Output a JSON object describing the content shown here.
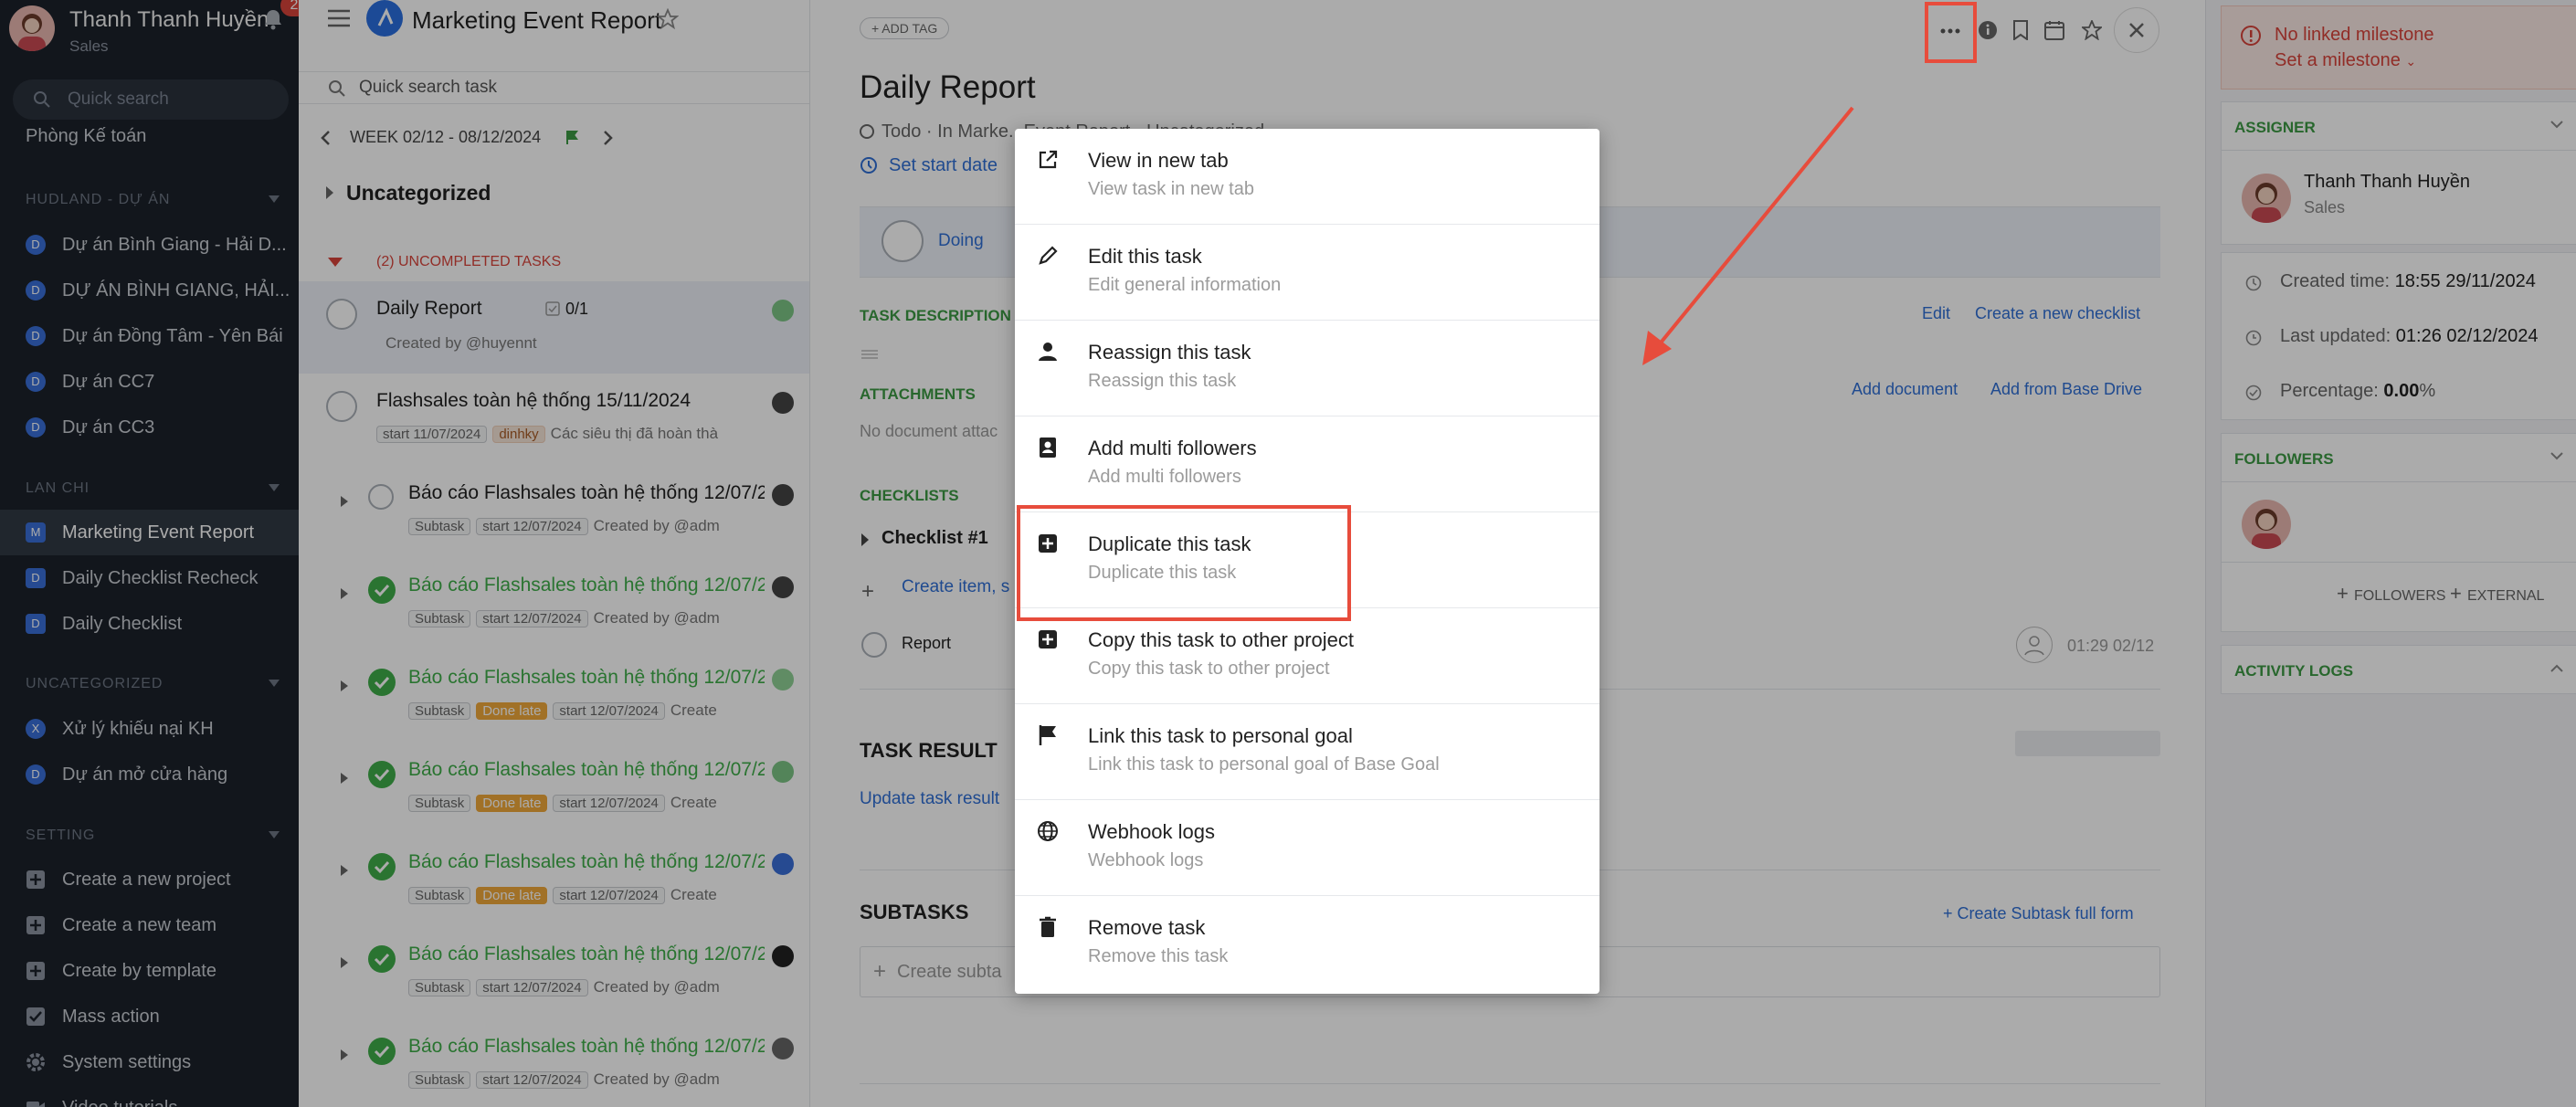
{
  "sidebar": {
    "user_name": "Thanh Thanh Huyền",
    "user_role": "Sales",
    "notif_count": "2",
    "search_placeholder": "Quick search",
    "partial_item": "Phòng Kế toán",
    "sections": [
      {
        "title": "HUDLAND - DỰ ÁN",
        "items": [
          {
            "letter": "D",
            "label": "Dự án Bình Giang - Hải D..."
          },
          {
            "letter": "D",
            "label": "DỰ ÁN BÌNH GIANG, HẢI..."
          },
          {
            "letter": "D",
            "label": "Dự án Đồng Tâm - Yên Bái"
          },
          {
            "letter": "D",
            "label": "Dự án CC7"
          },
          {
            "letter": "D",
            "label": "Dự án CC3"
          }
        ]
      },
      {
        "title": "LAN CHI",
        "items": [
          {
            "letter": "M",
            "label": "Marketing Event Report"
          },
          {
            "letter": "D",
            "label": "Daily Checklist Recheck"
          },
          {
            "letter": "D",
            "label": "Daily Checklist"
          }
        ]
      },
      {
        "title": "UNCATEGORIZED",
        "items": [
          {
            "letter": "X",
            "label": "Xử lý khiếu nại KH"
          },
          {
            "letter": "D",
            "label": "Dự án mở cửa hàng"
          }
        ]
      },
      {
        "title": "SETTING",
        "items": [
          {
            "label": "Create a new project"
          },
          {
            "label": "Create a new team"
          },
          {
            "label": "Create by template"
          },
          {
            "label": "Mass action"
          },
          {
            "label": "System settings"
          },
          {
            "label": "Video tutorials"
          }
        ]
      }
    ]
  },
  "list": {
    "project_title": "Marketing Event Report",
    "quick_search": "Quick search task",
    "week": "WEEK 02/12 - 08/12/2024",
    "group": "Uncategorized",
    "uncompleted": "(2) UNCOMPLETED TASKS",
    "tasks": [
      {
        "title": "Daily Report",
        "checklist": "0/1",
        "sub": "Created by @huyennt"
      },
      {
        "title": "Flashsales toàn hệ thống 15/11/2024",
        "tags": [
          "start 11/07/2024",
          "dinhky"
        ],
        "sub": "Các siêu thị đã hoàn thà"
      },
      {
        "title": "Báo cáo Flashsales toàn hệ thống 12/07/2",
        "tags": [
          "Subtask",
          "start 12/07/2024"
        ],
        "sub": "Created by @adm"
      },
      {
        "title": "Báo cáo Flashsales toàn hệ thống 12/07/2",
        "tags": [
          "Subtask",
          "start 12/07/2024"
        ],
        "sub": "Created by @adm"
      },
      {
        "title": "Báo cáo Flashsales toàn hệ thống 12/07/2",
        "tags": [
          "Subtask",
          "Done late",
          "start 12/07/2024"
        ],
        "sub": "Create"
      },
      {
        "title": "Báo cáo Flashsales toàn hệ thống 12/07/2",
        "tags": [
          "Subtask",
          "Done late",
          "start 12/07/2024"
        ],
        "sub": "Create"
      },
      {
        "title": "Báo cáo Flashsales toàn hệ thống 12/07/2",
        "tags": [
          "Subtask",
          "Done late",
          "start 12/07/2024"
        ],
        "sub": "Create"
      },
      {
        "title": "Báo cáo Flashsales toàn hệ thống 12/07/2",
        "tags": [
          "Subtask",
          "start 12/07/2024"
        ],
        "sub": "Created by @adm"
      },
      {
        "title": "Báo cáo Flashsales toàn hệ thống 12/07/2",
        "tags": [
          "Subtask",
          "start 12/07/2024"
        ],
        "sub": "Created by @adm"
      }
    ]
  },
  "detail": {
    "add_tag": "+ ADD TAG",
    "title": "Daily Report",
    "meta_a": "Todo · In Marke",
    "meta_b": "...Event Report · Uncategorized",
    "set_start": "Set start date",
    "status": "Doing",
    "desc_head": "TASK DESCRIPTION",
    "edit": "Edit",
    "new_checklist": "Create a new checklist",
    "att_head": "ATTACHMENTS",
    "add_doc": "Add document",
    "add_drive": "Add from Base Drive",
    "no_doc": "No document attac",
    "check_head": "CHECKLISTS",
    "checklist_name": "Checklist #1",
    "create_item": "Create item, s",
    "check_item": "Report",
    "check_time": "01:29 02/12",
    "result_head": "TASK RESULT",
    "update_result": "Update task result",
    "subtasks_head": "SUBTASKS",
    "create_subtask_full": "Create Subtask full form",
    "create_subtask": "Create subta"
  },
  "right": {
    "milestone": "No linked milestone",
    "set_milestone": "Set a milestone",
    "assigner_head": "ASSIGNER",
    "assigner_name": "Thanh Thanh Huyền",
    "assigner_role": "Sales",
    "created_label": "Created time:",
    "created_val": "18:55 29/11/2024",
    "updated_label": "Last updated:",
    "updated_val": "01:26 02/12/2024",
    "pct_label": "Percentage:",
    "pct_val": "0.00",
    "pct_unit": "%",
    "followers_head": "FOLLOWERS",
    "followers_btn": "FOLLOWERS",
    "external_btn": "EXTERNAL",
    "activity_head": "ACTIVITY LOGS"
  },
  "menu": [
    {
      "icon": "external-link-icon",
      "label": "View in new tab",
      "sub": "View task in new tab"
    },
    {
      "icon": "pencil-icon",
      "label": "Edit this task",
      "sub": "Edit general information"
    },
    {
      "icon": "person-icon",
      "label": "Reassign this task",
      "sub": "Reassign this task"
    },
    {
      "icon": "contacts-icon",
      "label": "Add multi followers",
      "sub": "Add multi followers"
    },
    {
      "icon": "plus-square-icon",
      "label": "Duplicate this task",
      "sub": "Duplicate this task"
    },
    {
      "icon": "plus-square-icon",
      "label": "Copy this task to other project",
      "sub": "Copy this task to other project"
    },
    {
      "icon": "flag-icon",
      "label": "Link this task to personal goal",
      "sub": "Link this task to personal goal of Base Goal"
    },
    {
      "icon": "globe-icon",
      "label": "Webhook logs",
      "sub": "Webhook logs"
    },
    {
      "icon": "trash-icon",
      "label": "Remove task",
      "sub": "Remove this task"
    }
  ],
  "colors": {
    "accent": "#2f6fd6",
    "highlight": "#e74c3c",
    "success": "#3fae49",
    "sidebar": "#1c222b"
  }
}
